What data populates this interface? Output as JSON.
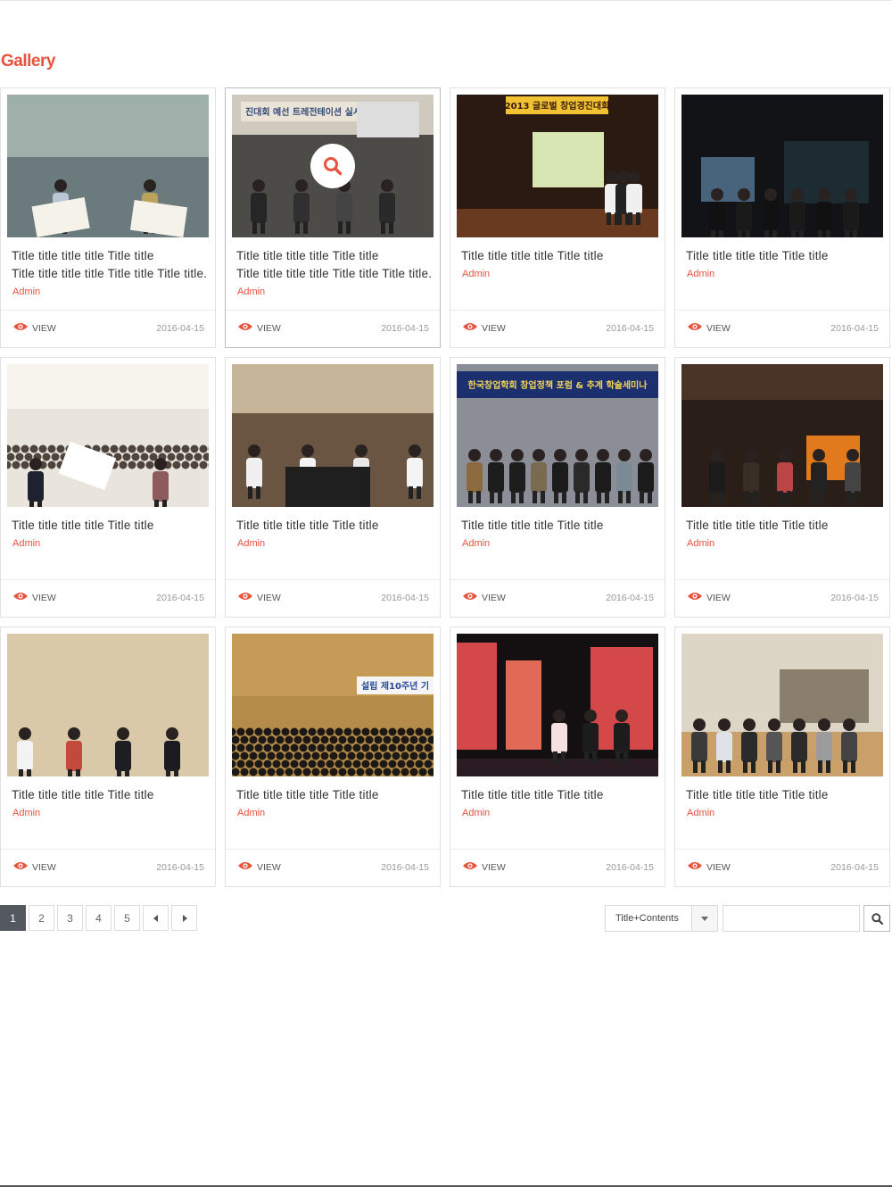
{
  "section_title": "Gallery",
  "cards": [
    {
      "title_lines": [
        "Title title title title Title title",
        "Title title title title Title title Title title...."
      ],
      "author": "Admin",
      "view_label": "VIEW",
      "date": "2016-04-15"
    },
    {
      "title_lines": [
        "Title title title title Title title",
        "Title title title title Title title Title title...."
      ],
      "author": "Admin",
      "view_label": "VIEW",
      "date": "2016-04-15"
    },
    {
      "title_lines": [
        "Title title title title Title title"
      ],
      "author": "Admin",
      "view_label": "VIEW",
      "date": "2016-04-15"
    },
    {
      "title_lines": [
        "Title title title title Title title"
      ],
      "author": "Admin",
      "view_label": "VIEW",
      "date": "2016-04-15"
    },
    {
      "title_lines": [
        "Title title title title Title title"
      ],
      "author": "Admin",
      "view_label": "VIEW",
      "date": "2016-04-15"
    },
    {
      "title_lines": [
        "Title title title title Title title"
      ],
      "author": "Admin",
      "view_label": "VIEW",
      "date": "2016-04-15"
    },
    {
      "title_lines": [
        "Title title title title Title title"
      ],
      "author": "Admin",
      "view_label": "VIEW",
      "date": "2016-04-15"
    },
    {
      "title_lines": [
        "Title title title title Title title"
      ],
      "author": "Admin",
      "view_label": "VIEW",
      "date": "2016-04-15"
    },
    {
      "title_lines": [
        "Title title title title Title title"
      ],
      "author": "Admin",
      "view_label": "VIEW",
      "date": "2016-04-15"
    },
    {
      "title_lines": [
        "Title title title title Title title"
      ],
      "author": "Admin",
      "view_label": "VIEW",
      "date": "2016-04-15"
    },
    {
      "title_lines": [
        "Title title title title Title title"
      ],
      "author": "Admin",
      "view_label": "VIEW",
      "date": "2016-04-15"
    },
    {
      "title_lines": [
        "Title title title title Title title"
      ],
      "author": "Admin",
      "view_label": "VIEW",
      "date": "2016-04-15"
    }
  ],
  "photo_banners": {
    "card2": "진대회 예선 트레전테이션 실시",
    "card3": "2013 글로벌 창업경진대회",
    "card7": "한국창업학회 창업정책 포럼 & 추계 학술세미나",
    "card10": "설립 제10주년 기"
  },
  "pagination": {
    "pages": [
      "1",
      "2",
      "3",
      "4",
      "5"
    ],
    "active": "1",
    "prev": "◀",
    "next": "▶"
  },
  "search": {
    "scope_label": "Title+Contents",
    "query": "",
    "placeholder": ""
  },
  "colors": {
    "accent": "#e8533f",
    "active_page": "#54595f"
  },
  "icons": {
    "view": "eye-icon",
    "hover": "search-icon",
    "submit": "search-icon",
    "dropdown": "caret-down-icon"
  }
}
